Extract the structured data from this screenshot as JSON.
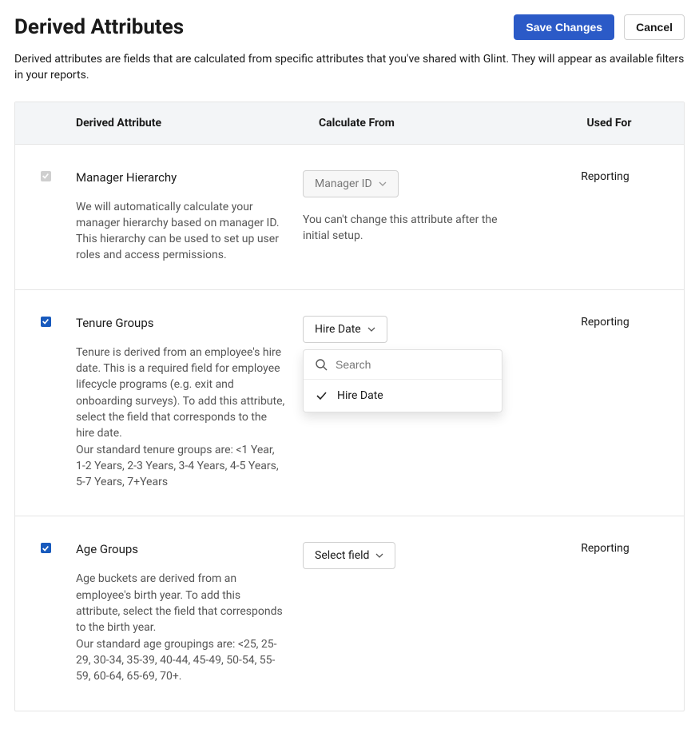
{
  "header": {
    "title": "Derived Attributes",
    "save_label": "Save Changes",
    "cancel_label": "Cancel",
    "description": "Derived attributes are fields that are calculated from specific attributes that you've shared with Glint. They will appear as available filters in your reports."
  },
  "columns": {
    "attr": "Derived Attribute",
    "calc": "Calculate From",
    "used": "Used For"
  },
  "rows": {
    "manager": {
      "checked": true,
      "disabled": true,
      "title": "Manager Hierarchy",
      "desc": "We will automatically calculate your manager hierarchy based on manager ID. This hierarchy can be used to set up user roles and access permissions.",
      "calc_label": "Manager ID",
      "helper": "You can't change this attribute after the initial setup.",
      "used": "Reporting"
    },
    "tenure": {
      "checked": true,
      "disabled": false,
      "title": "Tenure Groups",
      "desc1": "Tenure is derived from an employee's hire date. This is a required field for employee lifecycle programs (e.g. exit and onboarding surveys). To add this attribute, select the field that corresponds to the hire date.",
      "desc2": "Our standard tenure groups are: <1 Year, 1-2 Years, 2-3 Years, 3-4 Years, 4-5 Years, 5-7 Years, 7+Years",
      "calc_label": "Hire Date",
      "used": "Reporting",
      "dropdown": {
        "search_placeholder": "Search",
        "option0": "Hire Date"
      }
    },
    "age": {
      "checked": true,
      "disabled": false,
      "title": "Age Groups",
      "desc1": "Age buckets are derived from an employee's birth year. To add this attribute, select the field that corresponds to the birth year.",
      "desc2": "Our standard age groupings are: <25, 25-29, 30-34, 35-39, 40-44, 45-49, 50-54, 55-59, 60-64, 65-69, 70+.",
      "calc_label": "Select field",
      "used": "Reporting"
    }
  }
}
